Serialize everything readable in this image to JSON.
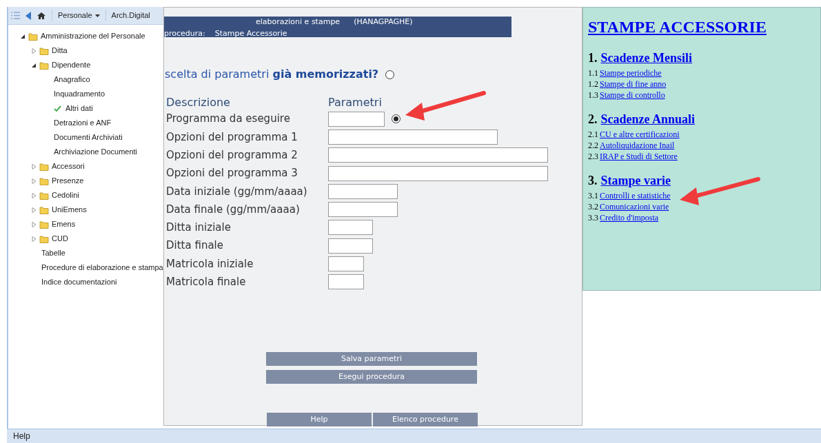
{
  "toolbar": {
    "menu": "Personale",
    "tab": "Arch.Digital"
  },
  "tree": [
    {
      "label": "Amministrazione del Personale",
      "kind": "folder",
      "expanded": true,
      "children": [
        {
          "label": "Ditta",
          "kind": "folder",
          "expanded": false
        },
        {
          "label": "Dipendente",
          "kind": "folder",
          "expanded": true,
          "children": [
            {
              "label": "Anagrafico",
              "kind": "leaf",
              "checked": false
            },
            {
              "label": "Inquadramento",
              "kind": "leaf",
              "checked": false
            },
            {
              "label": "Altri dati",
              "kind": "leaf",
              "checked": true
            },
            {
              "label": "Detrazioni e ANF",
              "kind": "leaf",
              "checked": false
            },
            {
              "label": "Documenti Archiviati",
              "kind": "leaf",
              "checked": false
            },
            {
              "label": "Archiviazione Documenti",
              "kind": "leaf",
              "checked": false
            }
          ]
        },
        {
          "label": "Accessori",
          "kind": "folder",
          "expanded": false
        },
        {
          "label": "Presenze",
          "kind": "folder",
          "expanded": false
        },
        {
          "label": "Cedolini",
          "kind": "folder",
          "expanded": false
        },
        {
          "label": "UniEmens",
          "kind": "folder",
          "expanded": false
        },
        {
          "label": "Emens",
          "kind": "folder",
          "expanded": false
        },
        {
          "label": "CUD",
          "kind": "folder",
          "expanded": false
        },
        {
          "label": "Tabelle",
          "kind": "leaf"
        },
        {
          "label": "Procedure di elaborazione e stampa",
          "kind": "leaf"
        },
        {
          "label": "Indice documentazioni",
          "kind": "leaf"
        }
      ]
    }
  ],
  "dialog": {
    "title": "elaborazioni e stampe",
    "code": "(HANAGPAGHE)",
    "procedure_label": "procedura:",
    "procedure": "Stampe Accessorie",
    "question": {
      "text": "scelta di parametri **già memorizzati?**",
      "selected": false
    },
    "columns": [
      "Descrizione",
      "Parametri"
    ],
    "rows": [
      {
        "label": "Programma da eseguire",
        "kind": "code",
        "selected": true
      },
      {
        "label": "Opzioni del programma 1",
        "kind": "medium"
      },
      {
        "label": "Opzioni del programma 2",
        "kind": "long"
      },
      {
        "label": "Opzioni del programma 3",
        "kind": "long"
      },
      {
        "label": "Data iniziale (gg/mm/aaaa)",
        "kind": "date"
      },
      {
        "label": "Data finale (gg/mm/aaaa)",
        "kind": "date"
      },
      {
        "label": "Ditta iniziale",
        "kind": "small"
      },
      {
        "label": "Ditta finale",
        "kind": "small"
      },
      {
        "label": "Matricola iniziale",
        "kind": "tiny"
      },
      {
        "label": "Matricola finale",
        "kind": "tiny"
      }
    ],
    "actions": [
      "Salva parametri",
      "Esegui procedura"
    ],
    "footer_buttons": [
      "Help",
      "Elenco procedure"
    ]
  },
  "help_panel": {
    "title": "STAMPE ACCESSORIE",
    "sections": [
      {
        "number": "1.",
        "title": "Scadenze Mensili",
        "links": [
          {
            "number": "1.1",
            "label": "Stampe periodiche"
          },
          {
            "number": "1.2",
            "label": "Stampe di fine anno"
          },
          {
            "number": "1.3",
            "label": "Stampe di controllo"
          }
        ]
      },
      {
        "number": "2.",
        "title": "Scadenze Annuali",
        "links": [
          {
            "number": "2.1",
            "label": "CU e altre certificazioni"
          },
          {
            "number": "2.2",
            "label": "Autoliquidazione Inail"
          },
          {
            "number": "2.3",
            "label": "IRAP e Studi di Settore"
          }
        ]
      },
      {
        "number": "3.",
        "title": "Stampe varie",
        "links": [
          {
            "number": "3.1",
            "label": "Controlli e statistiche"
          },
          {
            "number": "3.2",
            "label": "Comunicazioni varie"
          },
          {
            "number": "3.3",
            "label": "Credito d'imposta"
          }
        ]
      }
    ]
  },
  "status_bar": "Help"
}
